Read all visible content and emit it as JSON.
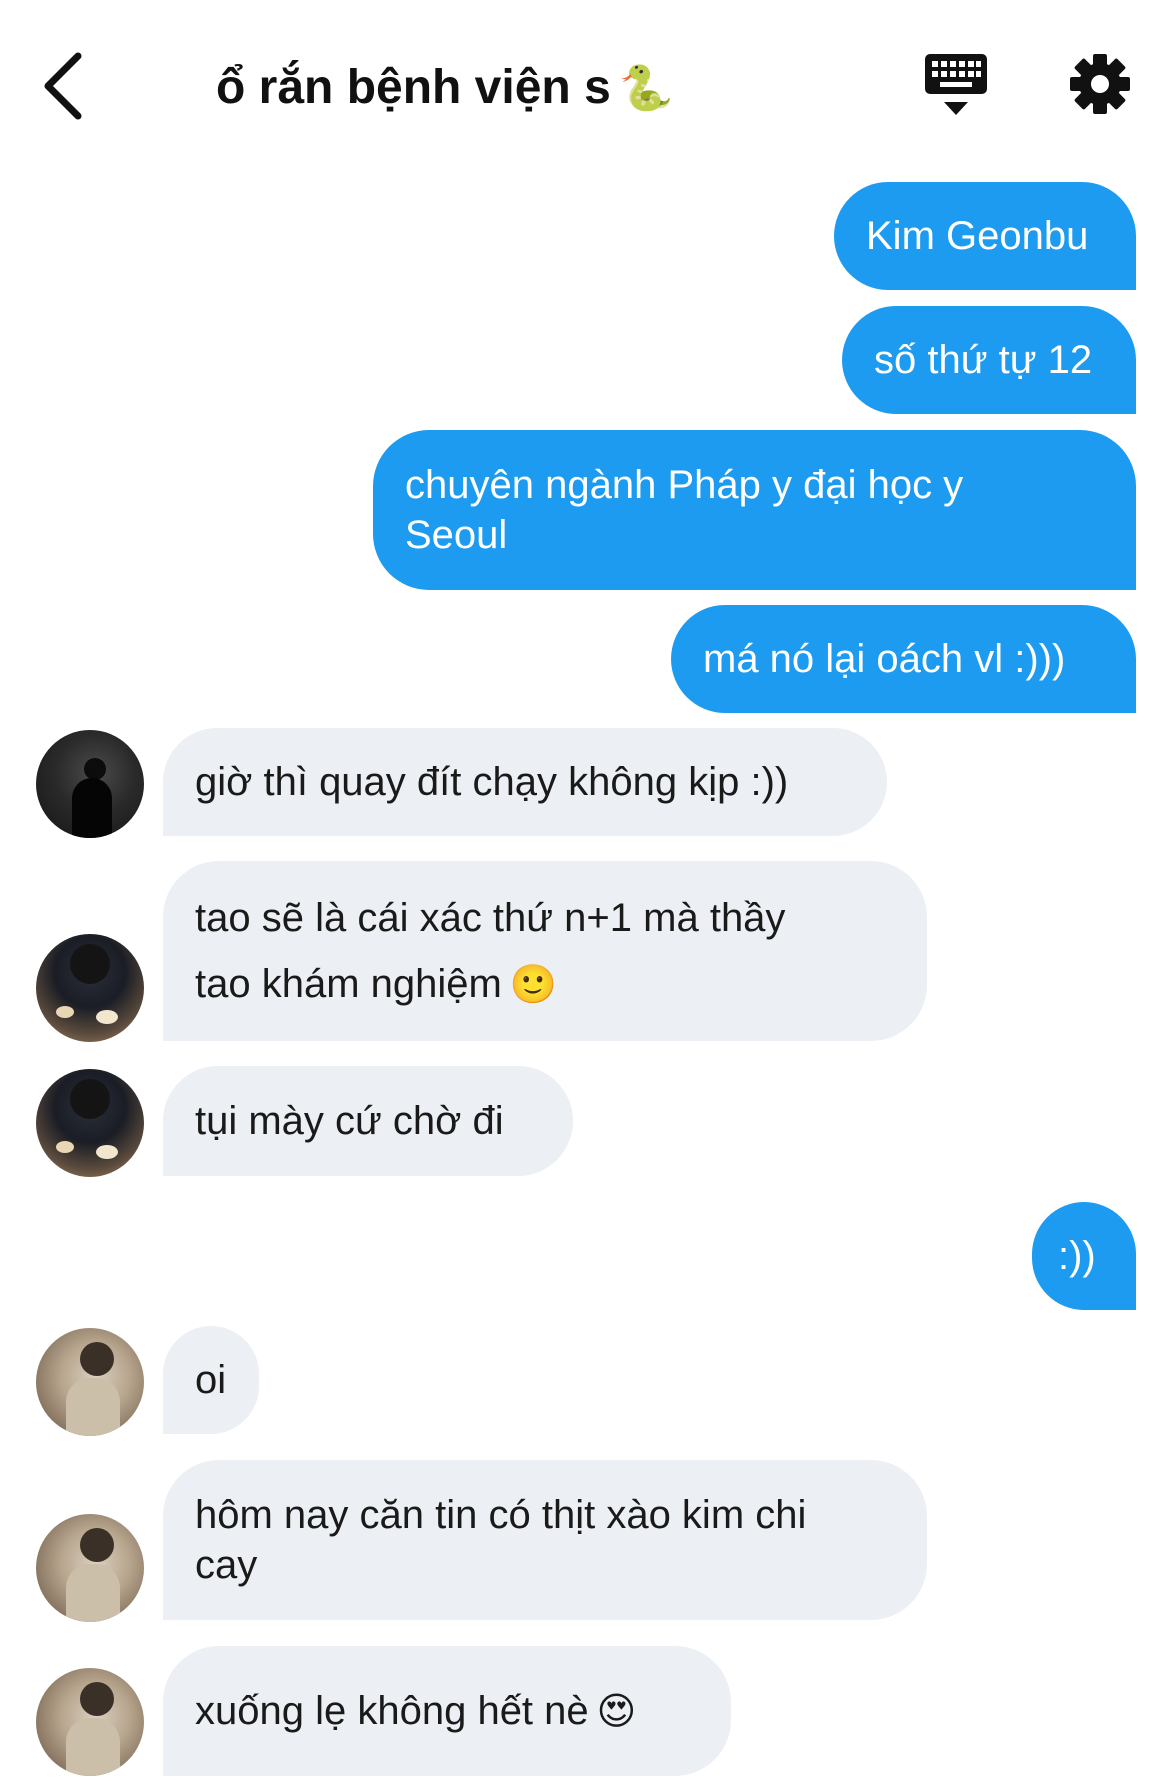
{
  "header": {
    "title": "ổ rắn bệnh viện s",
    "title_emoji": "🐍"
  },
  "colors": {
    "outgoing_bubble": "#1d9bf0",
    "incoming_bubble": "#eceff3"
  },
  "messages": [
    {
      "direction": "out",
      "text": "Kim Geonbu"
    },
    {
      "direction": "out",
      "text": "số thứ tự 12"
    },
    {
      "direction": "out",
      "text": "chuyên ngành Pháp y đại học y\nSeoul"
    },
    {
      "direction": "out",
      "text": "má nó lại oách vl :)))"
    },
    {
      "direction": "in",
      "text": "giờ thì quay đít chạy không kịp :))",
      "avatar": "dark-night-photo"
    },
    {
      "direction": "in",
      "text": "tao sẽ là cái xác thứ n+1 mà thầy\ntao khám nghiệm",
      "emoji": "🙂",
      "avatar": "food-table-photo"
    },
    {
      "direction": "in",
      "text": "tụi mày cứ chờ đi",
      "avatar": "food-table-photo"
    },
    {
      "direction": "out",
      "text": ":))"
    },
    {
      "direction": "in",
      "text": "oi",
      "avatar": "mirror-selfie-photo"
    },
    {
      "direction": "in",
      "text": "hôm nay căn tin có thịt xào kim chi\ncay",
      "avatar": "mirror-selfie-photo"
    },
    {
      "direction": "in",
      "text": "xuống lẹ không hết nè",
      "emoji": "😍",
      "avatar": "mirror-selfie-photo"
    }
  ]
}
